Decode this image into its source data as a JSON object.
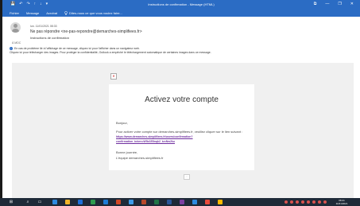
{
  "window": {
    "title": "Instructions de confirmation - Message (HTML)",
    "quick_access": [
      "💾",
      "↶",
      "↷",
      "↑",
      "↓",
      "▾"
    ],
    "controls": [
      "⧉",
      "—",
      "❐",
      "✕"
    ]
  },
  "ribbon": {
    "tabs": [
      "Fichier",
      "Message",
      "Acrobat"
    ],
    "tell_me": "Dites-nous ce que vous voulez faire..."
  },
  "message": {
    "date": "lun. 11/01/2021 08:33",
    "from": "Ne pas répondre <ne-pas-repondre@demarches-simplifiees.fr>",
    "subject": "Instructions de confirmation",
    "to_label": "À   MDC",
    "info_line1": "En cas de problème lié à l'affichage de ce message, cliquez ici pour l'afficher dans un navigateur web.",
    "info_line2": "Cliquez ici pour télécharger des images. Pour protéger la confidentialité, Outlook a empêché le téléchargement automatique de certaines images dans ce message."
  },
  "email_body": {
    "heading": "Activez votre compte",
    "greeting": "Bonjour,",
    "instructions": "Pour activer votre compte sur demarches-simplifiees.fr, veuillez cliquer sur le lien suivant :",
    "link_line1": "https://www.demarches-simplifiees.fr/users/confirmation?",
    "link_line2": "confirmation_token=W5z1E8nqk2_tzxNw2ku",
    "closing": "Bonne journée,",
    "signature": "L'équipe demarches-simplifiees.fr"
  },
  "taskbar": {
    "time": "08:41",
    "date": "11/01/2021",
    "colors": [
      "#2f8ae0",
      "#f0b429",
      "#1e6fd9",
      "#2e9b4f",
      "#1e7cd6",
      "#d24726",
      "#3d9be9",
      "#b7472a",
      "#217346",
      "#2b579a",
      "#7b3fa0",
      "#2f8ae0",
      "#e94b3c",
      "#ffb900"
    ]
  }
}
